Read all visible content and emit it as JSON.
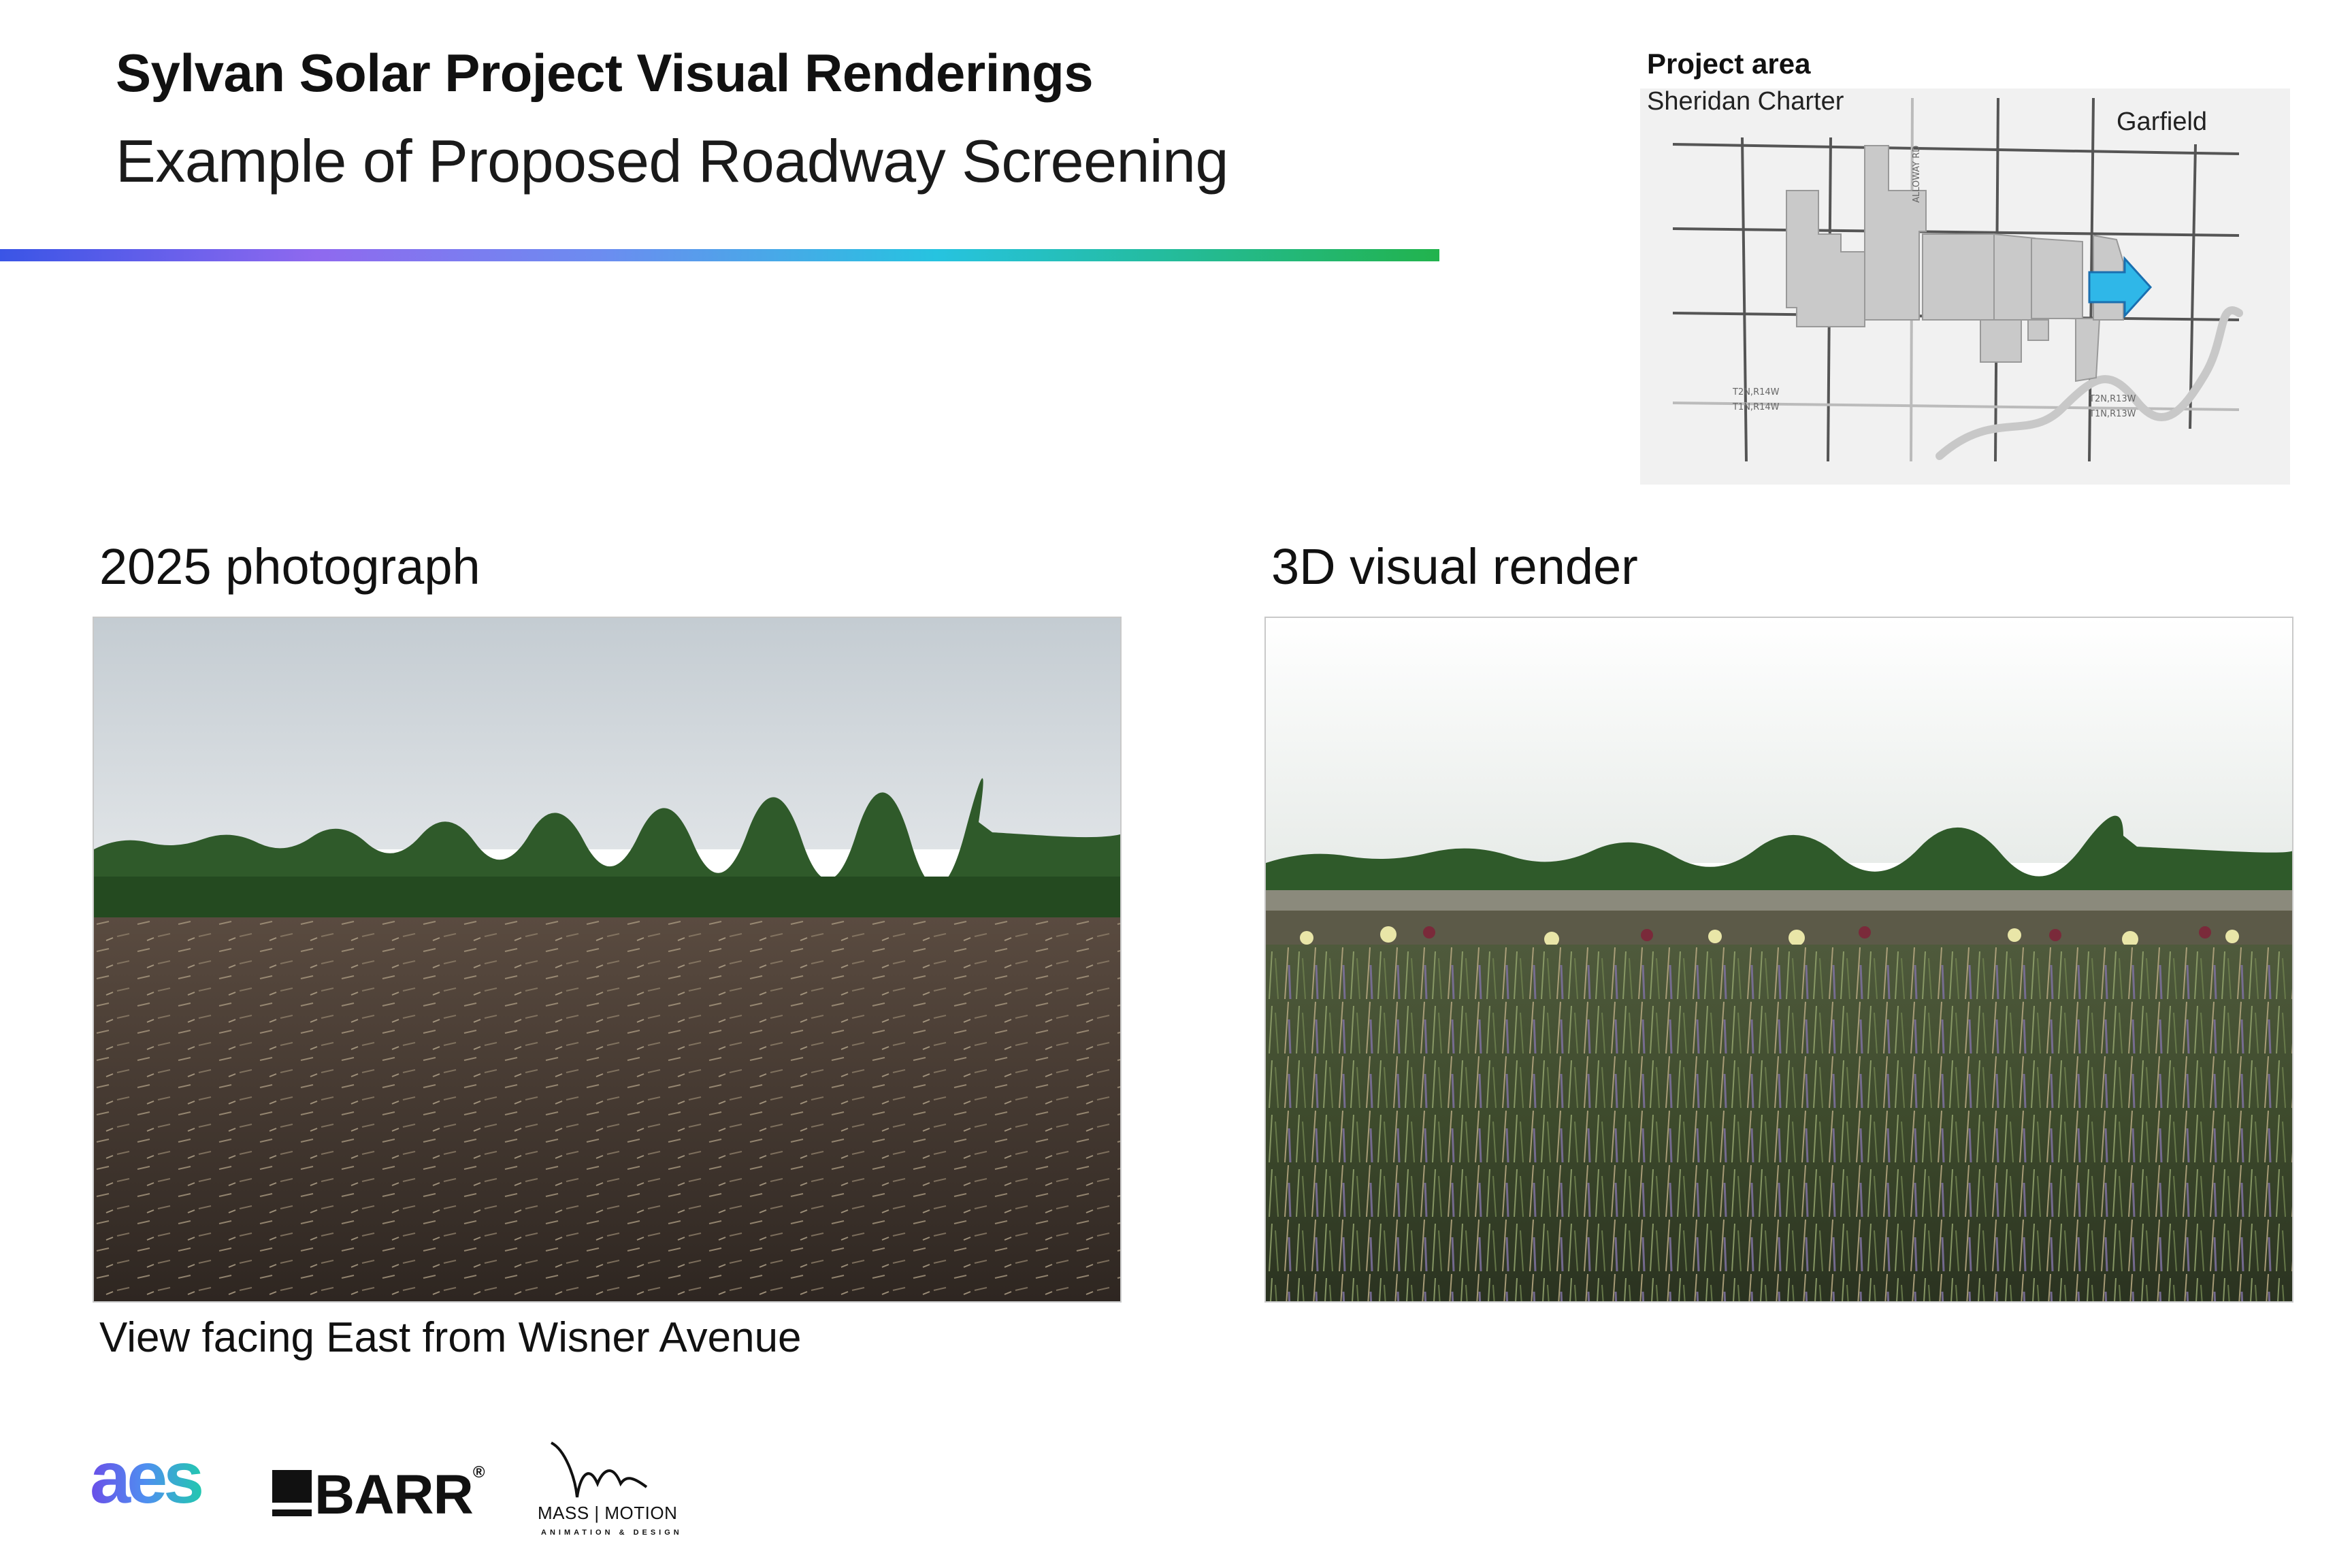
{
  "header": {
    "title": "Sylvan Solar Project Visual Renderings",
    "subtitle": "Example of Proposed Roadway Screening"
  },
  "locator_map": {
    "heading": "Project area",
    "township_left": "Sheridan Charter",
    "township_right": "Garfield",
    "road_label_vertical": "ALLOWAY RD",
    "section_labels": [
      "T2N,R14W",
      "T1N,R14W",
      "T2N,R13W",
      "T1N,R13W"
    ],
    "arrow_color": "#2fb7e8",
    "parcel_color": "#c9c9c9"
  },
  "photo": {
    "heading": "2025 photograph",
    "caption": "View facing East from Wisner Avenue"
  },
  "render": {
    "heading": "3D visual render"
  },
  "logos": {
    "aes": "aes",
    "barr": "BARR",
    "barr_mark": "®",
    "massmotion": "MASS | MOTION",
    "massmotion_sub": "ANIMATION & DESIGN"
  },
  "colors": {
    "rule_start": "#3a55e6",
    "rule_end": "#22b34d"
  }
}
